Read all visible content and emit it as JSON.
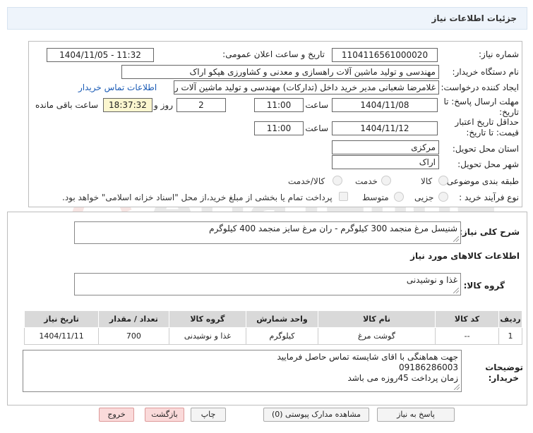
{
  "header": {
    "title": "جزئیات اطلاعات نیاز"
  },
  "form": {
    "need_number_label": "شماره نیاز:",
    "need_number": "1104116561000020",
    "announce_label": "تاریخ و ساعت اعلان عمومی:",
    "announce_value": "1404/11/05 - 11:32",
    "buyer_label": "نام دستگاه خریدار:",
    "buyer_value": "مهندسی و تولید ماشین آلات راهسازی و معدنی و کشاورزی هپکو اراک",
    "requester_label": "ایجاد کننده درخواست:",
    "requester_value": "غلامرضا شعبانی مدیر خرید داخل (تدارکات) مهندسی و تولید ماشین آلات راهسازی",
    "contact_link": "اطلاعات تماس خریدار",
    "deadline_label_1": "مهلت ارسال پاسخ: تا",
    "deadline_label_2": "تاریخ:",
    "deadline_date": "1404/11/08",
    "time_label": "ساعت",
    "deadline_time": "11:00",
    "days_value": "2",
    "days_label": "روز و",
    "remaining_time": "18:37:32",
    "remaining_label": "ساعت باقی مانده",
    "validity_label_1": "حداقل تاریخ اعتبار",
    "validity_label_2": "قیمت: تا تاریخ:",
    "validity_date": "1404/11/12",
    "validity_time": "11:00",
    "province_label": "استان محل تحویل:",
    "province_value": "مرکزی",
    "city_label": "شهر محل تحویل:",
    "city_value": "اراک",
    "category_label": "طبقه بندی موضوعی:",
    "category_options": [
      "کالا",
      "خدمت",
      "کالا/خدمت"
    ],
    "process_label": "نوع فرآیند خرید :",
    "process_options": [
      "جزیی",
      "متوسط"
    ],
    "payment_note": "پرداخت تمام یا بخشی از مبلغ خرید،از محل \"اسناد خزانه اسلامی\" خواهد بود."
  },
  "details": {
    "summary_label": "شرح کلی نیاز:",
    "summary_value": "شنیسل مرغ منجمد 300 کیلوگرم - ران مرغ سایز منجمد 400 کیلوگرم",
    "goods_info_label": "اطلاعات کالاهای مورد نیاز",
    "goods_group_label": "گروه کالا:",
    "goods_group_value": "غذا و نوشیدنی"
  },
  "table": {
    "headers": [
      "ردیف",
      "کد کالا",
      "نام کالا",
      "واحد شمارش",
      "گروه کالا",
      "تعداد / مقدار",
      "تاریخ نیاز"
    ],
    "rows": [
      [
        "1",
        "--",
        "گوشت مرغ",
        "کیلوگرم",
        "غذا و نوشیدنی",
        "700",
        "1404/11/11"
      ]
    ]
  },
  "notes": {
    "label_1": "توضیحات",
    "label_2": "خریدار:",
    "lines": [
      "جهت هماهنگی با اقای شایسته تماس حاصل فرمایید",
      "09186286003",
      "زمان پرداخت  45روزه می باشد"
    ]
  },
  "buttons": {
    "reply": "پاسخ به نیاز",
    "view_docs": "مشاهده مدارک پیوستی (0)",
    "print": "چاپ",
    "back": "بازگشت",
    "exit": "خروج"
  },
  "watermark": {
    "text": "AriaTender.neT"
  }
}
